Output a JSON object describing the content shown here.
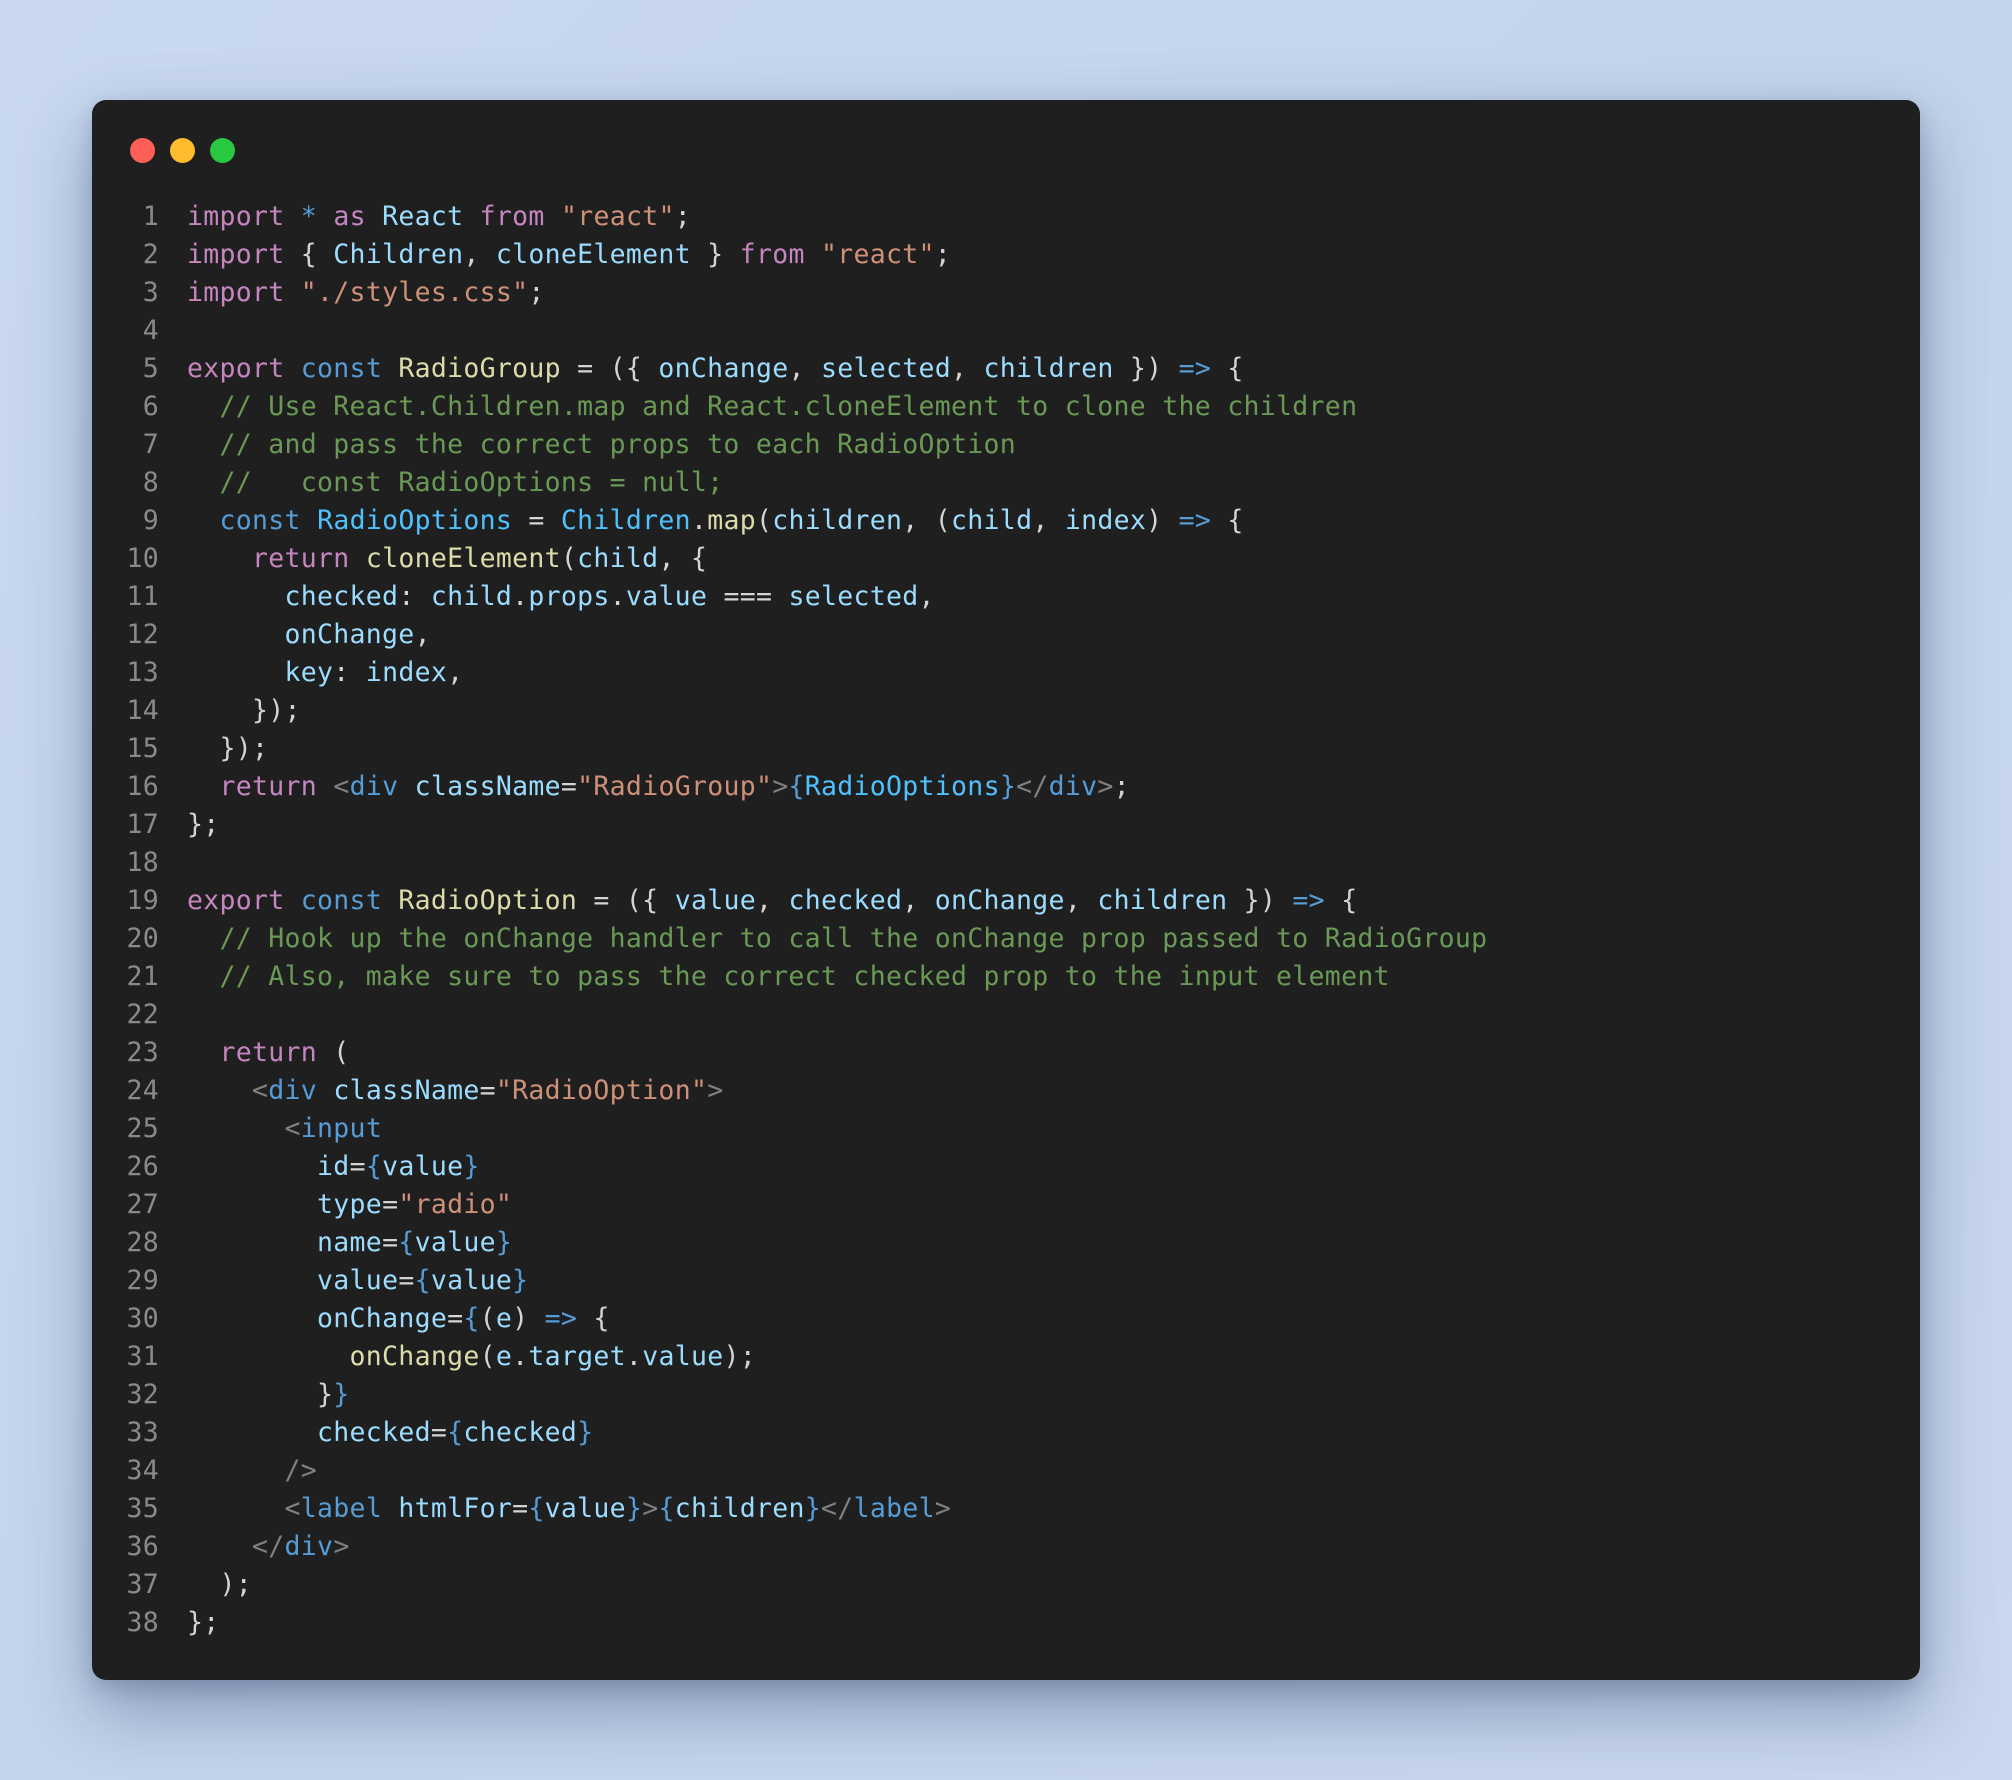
{
  "window": {
    "controls": [
      {
        "name": "close",
        "color": "#ff5f57"
      },
      {
        "name": "minimize",
        "color": "#febc2e"
      },
      {
        "name": "maximize",
        "color": "#28c840"
      }
    ]
  },
  "syntax_colors": {
    "keyword": "#c586c0",
    "string": "#ce9178",
    "identifier": "#9cdcfe",
    "function": "#dcdcaa",
    "comment": "#6a9955",
    "declaration": "#569cd6",
    "type": "#4fc1ff",
    "punctuation": "#d4d4d4",
    "tag": "#569cd6",
    "angle_bracket": "#808080",
    "line_number": "#8a8a8a",
    "background": "#1f1f1f"
  },
  "code": {
    "language": "jsx",
    "lines": [
      {
        "n": "1",
        "t": [
          [
            "kw",
            "import"
          ],
          [
            "pu",
            " "
          ],
          [
            "dk",
            "*"
          ],
          [
            "pu",
            " "
          ],
          [
            "kw",
            "as"
          ],
          [
            "pu",
            " "
          ],
          [
            "id",
            "React"
          ],
          [
            "pu",
            " "
          ],
          [
            "kw",
            "from"
          ],
          [
            "pu",
            " "
          ],
          [
            "st",
            "\"react\""
          ],
          [
            "pu",
            ";"
          ]
        ]
      },
      {
        "n": "2",
        "t": [
          [
            "kw",
            "import"
          ],
          [
            "pu",
            " { "
          ],
          [
            "id",
            "Children"
          ],
          [
            "pu",
            ", "
          ],
          [
            "id",
            "cloneElement"
          ],
          [
            "pu",
            " } "
          ],
          [
            "kw",
            "from"
          ],
          [
            "pu",
            " "
          ],
          [
            "st",
            "\"react\""
          ],
          [
            "pu",
            ";"
          ]
        ]
      },
      {
        "n": "3",
        "t": [
          [
            "kw",
            "import"
          ],
          [
            "pu",
            " "
          ],
          [
            "st",
            "\"./styles.css\""
          ],
          [
            "pu",
            ";"
          ]
        ]
      },
      {
        "n": "4",
        "t": []
      },
      {
        "n": "5",
        "t": [
          [
            "kw",
            "export"
          ],
          [
            "pu",
            " "
          ],
          [
            "dk",
            "const"
          ],
          [
            "pu",
            " "
          ],
          [
            "fn",
            "RadioGroup"
          ],
          [
            "pu",
            " = ({ "
          ],
          [
            "id",
            "onChange"
          ],
          [
            "pu",
            ", "
          ],
          [
            "id",
            "selected"
          ],
          [
            "pu",
            ", "
          ],
          [
            "id",
            "children"
          ],
          [
            "pu",
            " }) "
          ],
          [
            "dk",
            "=>"
          ],
          [
            "pu",
            " {"
          ]
        ]
      },
      {
        "n": "6",
        "t": [
          [
            "pu",
            "  "
          ],
          [
            "cm",
            "// Use React.Children.map and React.cloneElement to clone the children"
          ]
        ]
      },
      {
        "n": "7",
        "t": [
          [
            "pu",
            "  "
          ],
          [
            "cm",
            "// and pass the correct props to each RadioOption"
          ]
        ]
      },
      {
        "n": "8",
        "t": [
          [
            "pu",
            "  "
          ],
          [
            "cm",
            "//   const RadioOptions = null;"
          ]
        ]
      },
      {
        "n": "9",
        "t": [
          [
            "pu",
            "  "
          ],
          [
            "dk",
            "const"
          ],
          [
            "pu",
            " "
          ],
          [
            "ty",
            "RadioOptions"
          ],
          [
            "pu",
            " = "
          ],
          [
            "ty",
            "Children"
          ],
          [
            "pu",
            "."
          ],
          [
            "fn",
            "map"
          ],
          [
            "pu",
            "("
          ],
          [
            "id",
            "children"
          ],
          [
            "pu",
            ", ("
          ],
          [
            "id",
            "child"
          ],
          [
            "pu",
            ", "
          ],
          [
            "id",
            "index"
          ],
          [
            "pu",
            ") "
          ],
          [
            "dk",
            "=>"
          ],
          [
            "pu",
            " {"
          ]
        ]
      },
      {
        "n": "10",
        "t": [
          [
            "pu",
            "    "
          ],
          [
            "kw",
            "return"
          ],
          [
            "pu",
            " "
          ],
          [
            "fn",
            "cloneElement"
          ],
          [
            "pu",
            "("
          ],
          [
            "id",
            "child"
          ],
          [
            "pu",
            ", {"
          ]
        ]
      },
      {
        "n": "11",
        "t": [
          [
            "pu",
            "      "
          ],
          [
            "id",
            "checked"
          ],
          [
            "pu",
            ": "
          ],
          [
            "id",
            "child"
          ],
          [
            "pu",
            "."
          ],
          [
            "id",
            "props"
          ],
          [
            "pu",
            "."
          ],
          [
            "id",
            "value"
          ],
          [
            "pu",
            " === "
          ],
          [
            "id",
            "selected"
          ],
          [
            "pu",
            ","
          ]
        ]
      },
      {
        "n": "12",
        "t": [
          [
            "pu",
            "      "
          ],
          [
            "id",
            "onChange"
          ],
          [
            "pu",
            ","
          ]
        ]
      },
      {
        "n": "13",
        "t": [
          [
            "pu",
            "      "
          ],
          [
            "id",
            "key"
          ],
          [
            "pu",
            ": "
          ],
          [
            "id",
            "index"
          ],
          [
            "pu",
            ","
          ]
        ]
      },
      {
        "n": "14",
        "t": [
          [
            "pu",
            "    });"
          ]
        ]
      },
      {
        "n": "15",
        "t": [
          [
            "pu",
            "  });"
          ]
        ]
      },
      {
        "n": "16",
        "t": [
          [
            "pu",
            "  "
          ],
          [
            "kw",
            "return"
          ],
          [
            "pu",
            " "
          ],
          [
            "ab",
            "<"
          ],
          [
            "tg",
            "div"
          ],
          [
            "pu",
            " "
          ],
          [
            "id",
            "className"
          ],
          [
            "pu",
            "="
          ],
          [
            "st",
            "\"RadioGroup\""
          ],
          [
            "ab",
            ">"
          ],
          [
            "dk",
            "{"
          ],
          [
            "ty",
            "RadioOptions"
          ],
          [
            "dk",
            "}"
          ],
          [
            "ab",
            "</"
          ],
          [
            "tg",
            "div"
          ],
          [
            "ab",
            ">"
          ],
          [
            "pu",
            ";"
          ]
        ]
      },
      {
        "n": "17",
        "t": [
          [
            "pu",
            "};"
          ]
        ]
      },
      {
        "n": "18",
        "t": []
      },
      {
        "n": "19",
        "t": [
          [
            "kw",
            "export"
          ],
          [
            "pu",
            " "
          ],
          [
            "dk",
            "const"
          ],
          [
            "pu",
            " "
          ],
          [
            "fn",
            "RadioOption"
          ],
          [
            "pu",
            " = ({ "
          ],
          [
            "id",
            "value"
          ],
          [
            "pu",
            ", "
          ],
          [
            "id",
            "checked"
          ],
          [
            "pu",
            ", "
          ],
          [
            "id",
            "onChange"
          ],
          [
            "pu",
            ", "
          ],
          [
            "id",
            "children"
          ],
          [
            "pu",
            " }) "
          ],
          [
            "dk",
            "=>"
          ],
          [
            "pu",
            " {"
          ]
        ]
      },
      {
        "n": "20",
        "t": [
          [
            "pu",
            "  "
          ],
          [
            "cm",
            "// Hook up the onChange handler to call the onChange prop passed to RadioGroup"
          ]
        ]
      },
      {
        "n": "21",
        "t": [
          [
            "pu",
            "  "
          ],
          [
            "cm",
            "// Also, make sure to pass the correct checked prop to the input element"
          ]
        ]
      },
      {
        "n": "22",
        "t": []
      },
      {
        "n": "23",
        "t": [
          [
            "pu",
            "  "
          ],
          [
            "kw",
            "return"
          ],
          [
            "pu",
            " ("
          ]
        ]
      },
      {
        "n": "24",
        "t": [
          [
            "pu",
            "    "
          ],
          [
            "ab",
            "<"
          ],
          [
            "tg",
            "div"
          ],
          [
            "pu",
            " "
          ],
          [
            "id",
            "className"
          ],
          [
            "pu",
            "="
          ],
          [
            "st",
            "\"RadioOption\""
          ],
          [
            "ab",
            ">"
          ]
        ]
      },
      {
        "n": "25",
        "t": [
          [
            "pu",
            "      "
          ],
          [
            "ab",
            "<"
          ],
          [
            "tg",
            "input"
          ]
        ]
      },
      {
        "n": "26",
        "t": [
          [
            "pu",
            "        "
          ],
          [
            "id",
            "id"
          ],
          [
            "pu",
            "="
          ],
          [
            "dk",
            "{"
          ],
          [
            "id",
            "value"
          ],
          [
            "dk",
            "}"
          ]
        ]
      },
      {
        "n": "27",
        "t": [
          [
            "pu",
            "        "
          ],
          [
            "id",
            "type"
          ],
          [
            "pu",
            "="
          ],
          [
            "st",
            "\"radio\""
          ]
        ]
      },
      {
        "n": "28",
        "t": [
          [
            "pu",
            "        "
          ],
          [
            "id",
            "name"
          ],
          [
            "pu",
            "="
          ],
          [
            "dk",
            "{"
          ],
          [
            "id",
            "value"
          ],
          [
            "dk",
            "}"
          ]
        ]
      },
      {
        "n": "29",
        "t": [
          [
            "pu",
            "        "
          ],
          [
            "id",
            "value"
          ],
          [
            "pu",
            "="
          ],
          [
            "dk",
            "{"
          ],
          [
            "id",
            "value"
          ],
          [
            "dk",
            "}"
          ]
        ]
      },
      {
        "n": "30",
        "t": [
          [
            "pu",
            "        "
          ],
          [
            "id",
            "onChange"
          ],
          [
            "pu",
            "="
          ],
          [
            "dk",
            "{"
          ],
          [
            "pu",
            "("
          ],
          [
            "id",
            "e"
          ],
          [
            "pu",
            ") "
          ],
          [
            "dk",
            "=>"
          ],
          [
            "pu",
            " {"
          ]
        ]
      },
      {
        "n": "31",
        "t": [
          [
            "pu",
            "          "
          ],
          [
            "fn",
            "onChange"
          ],
          [
            "pu",
            "("
          ],
          [
            "id",
            "e"
          ],
          [
            "pu",
            "."
          ],
          [
            "id",
            "target"
          ],
          [
            "pu",
            "."
          ],
          [
            "id",
            "value"
          ],
          [
            "pu",
            ");"
          ]
        ]
      },
      {
        "n": "32",
        "t": [
          [
            "pu",
            "        }"
          ],
          [
            "dk",
            "}"
          ]
        ]
      },
      {
        "n": "33",
        "t": [
          [
            "pu",
            "        "
          ],
          [
            "id",
            "checked"
          ],
          [
            "pu",
            "="
          ],
          [
            "dk",
            "{"
          ],
          [
            "id",
            "checked"
          ],
          [
            "dk",
            "}"
          ]
        ]
      },
      {
        "n": "34",
        "t": [
          [
            "pu",
            "      "
          ],
          [
            "ab",
            "/>"
          ]
        ]
      },
      {
        "n": "35",
        "t": [
          [
            "pu",
            "      "
          ],
          [
            "ab",
            "<"
          ],
          [
            "tg",
            "label"
          ],
          [
            "pu",
            " "
          ],
          [
            "id",
            "htmlFor"
          ],
          [
            "pu",
            "="
          ],
          [
            "dk",
            "{"
          ],
          [
            "id",
            "value"
          ],
          [
            "dk",
            "}"
          ],
          [
            "ab",
            ">"
          ],
          [
            "dk",
            "{"
          ],
          [
            "id",
            "children"
          ],
          [
            "dk",
            "}"
          ],
          [
            "ab",
            "</"
          ],
          [
            "tg",
            "label"
          ],
          [
            "ab",
            ">"
          ]
        ]
      },
      {
        "n": "36",
        "t": [
          [
            "pu",
            "    "
          ],
          [
            "ab",
            "</"
          ],
          [
            "tg",
            "div"
          ],
          [
            "ab",
            ">"
          ]
        ]
      },
      {
        "n": "37",
        "t": [
          [
            "pu",
            "  );"
          ]
        ]
      },
      {
        "n": "38",
        "t": [
          [
            "pu",
            "};"
          ]
        ]
      }
    ]
  }
}
